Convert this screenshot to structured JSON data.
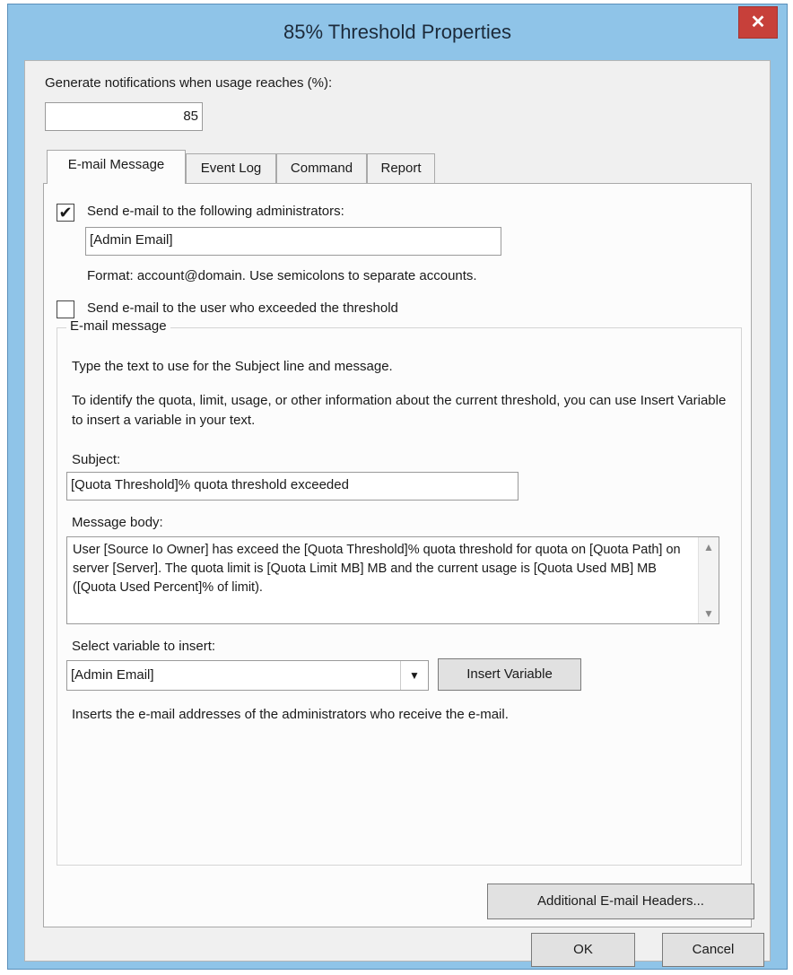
{
  "window": {
    "title": "85% Threshold Properties",
    "close_glyph": "✕"
  },
  "threshold": {
    "label": "Generate notifications when usage reaches (%):",
    "value": "85"
  },
  "tabs": [
    {
      "label": "E-mail Message"
    },
    {
      "label": "Event Log"
    },
    {
      "label": "Command"
    },
    {
      "label": "Report"
    }
  ],
  "email": {
    "send_admin_label": "Send e-mail to the following administrators:",
    "send_admin_checked": "✔",
    "admin_value": "[Admin Email]",
    "format_hint": "Format: account@domain. Use semicolons to separate accounts.",
    "send_user_label": "Send e-mail to the user who exceeded the threshold",
    "group_label": "E-mail message",
    "intro1": "Type the text to use for the Subject line and message.",
    "intro2": "To identify the quota, limit, usage, or other information about the current threshold, you can use Insert Variable to insert a variable in your text.",
    "subject_label": "Subject:",
    "subject_value": "[Quota Threshold]% quota threshold exceeded",
    "body_label": "Message body:",
    "body_value": "User [Source Io Owner] has exceed the [Quota Threshold]% quota threshold for quota on [Quota Path] on server [Server]. The quota limit is [Quota Limit MB] MB and the current usage is [Quota Used MB] MB ([Quota Used Percent]% of limit).",
    "variable_label": "Select variable to insert:",
    "variable_value": "[Admin Email]",
    "insert_button": "Insert Variable",
    "variable_hint": "Inserts the e-mail addresses of the administrators who receive the e-mail.",
    "headers_button": "Additional E-mail Headers..."
  },
  "buttons": {
    "ok": "OK",
    "cancel": "Cancel"
  }
}
